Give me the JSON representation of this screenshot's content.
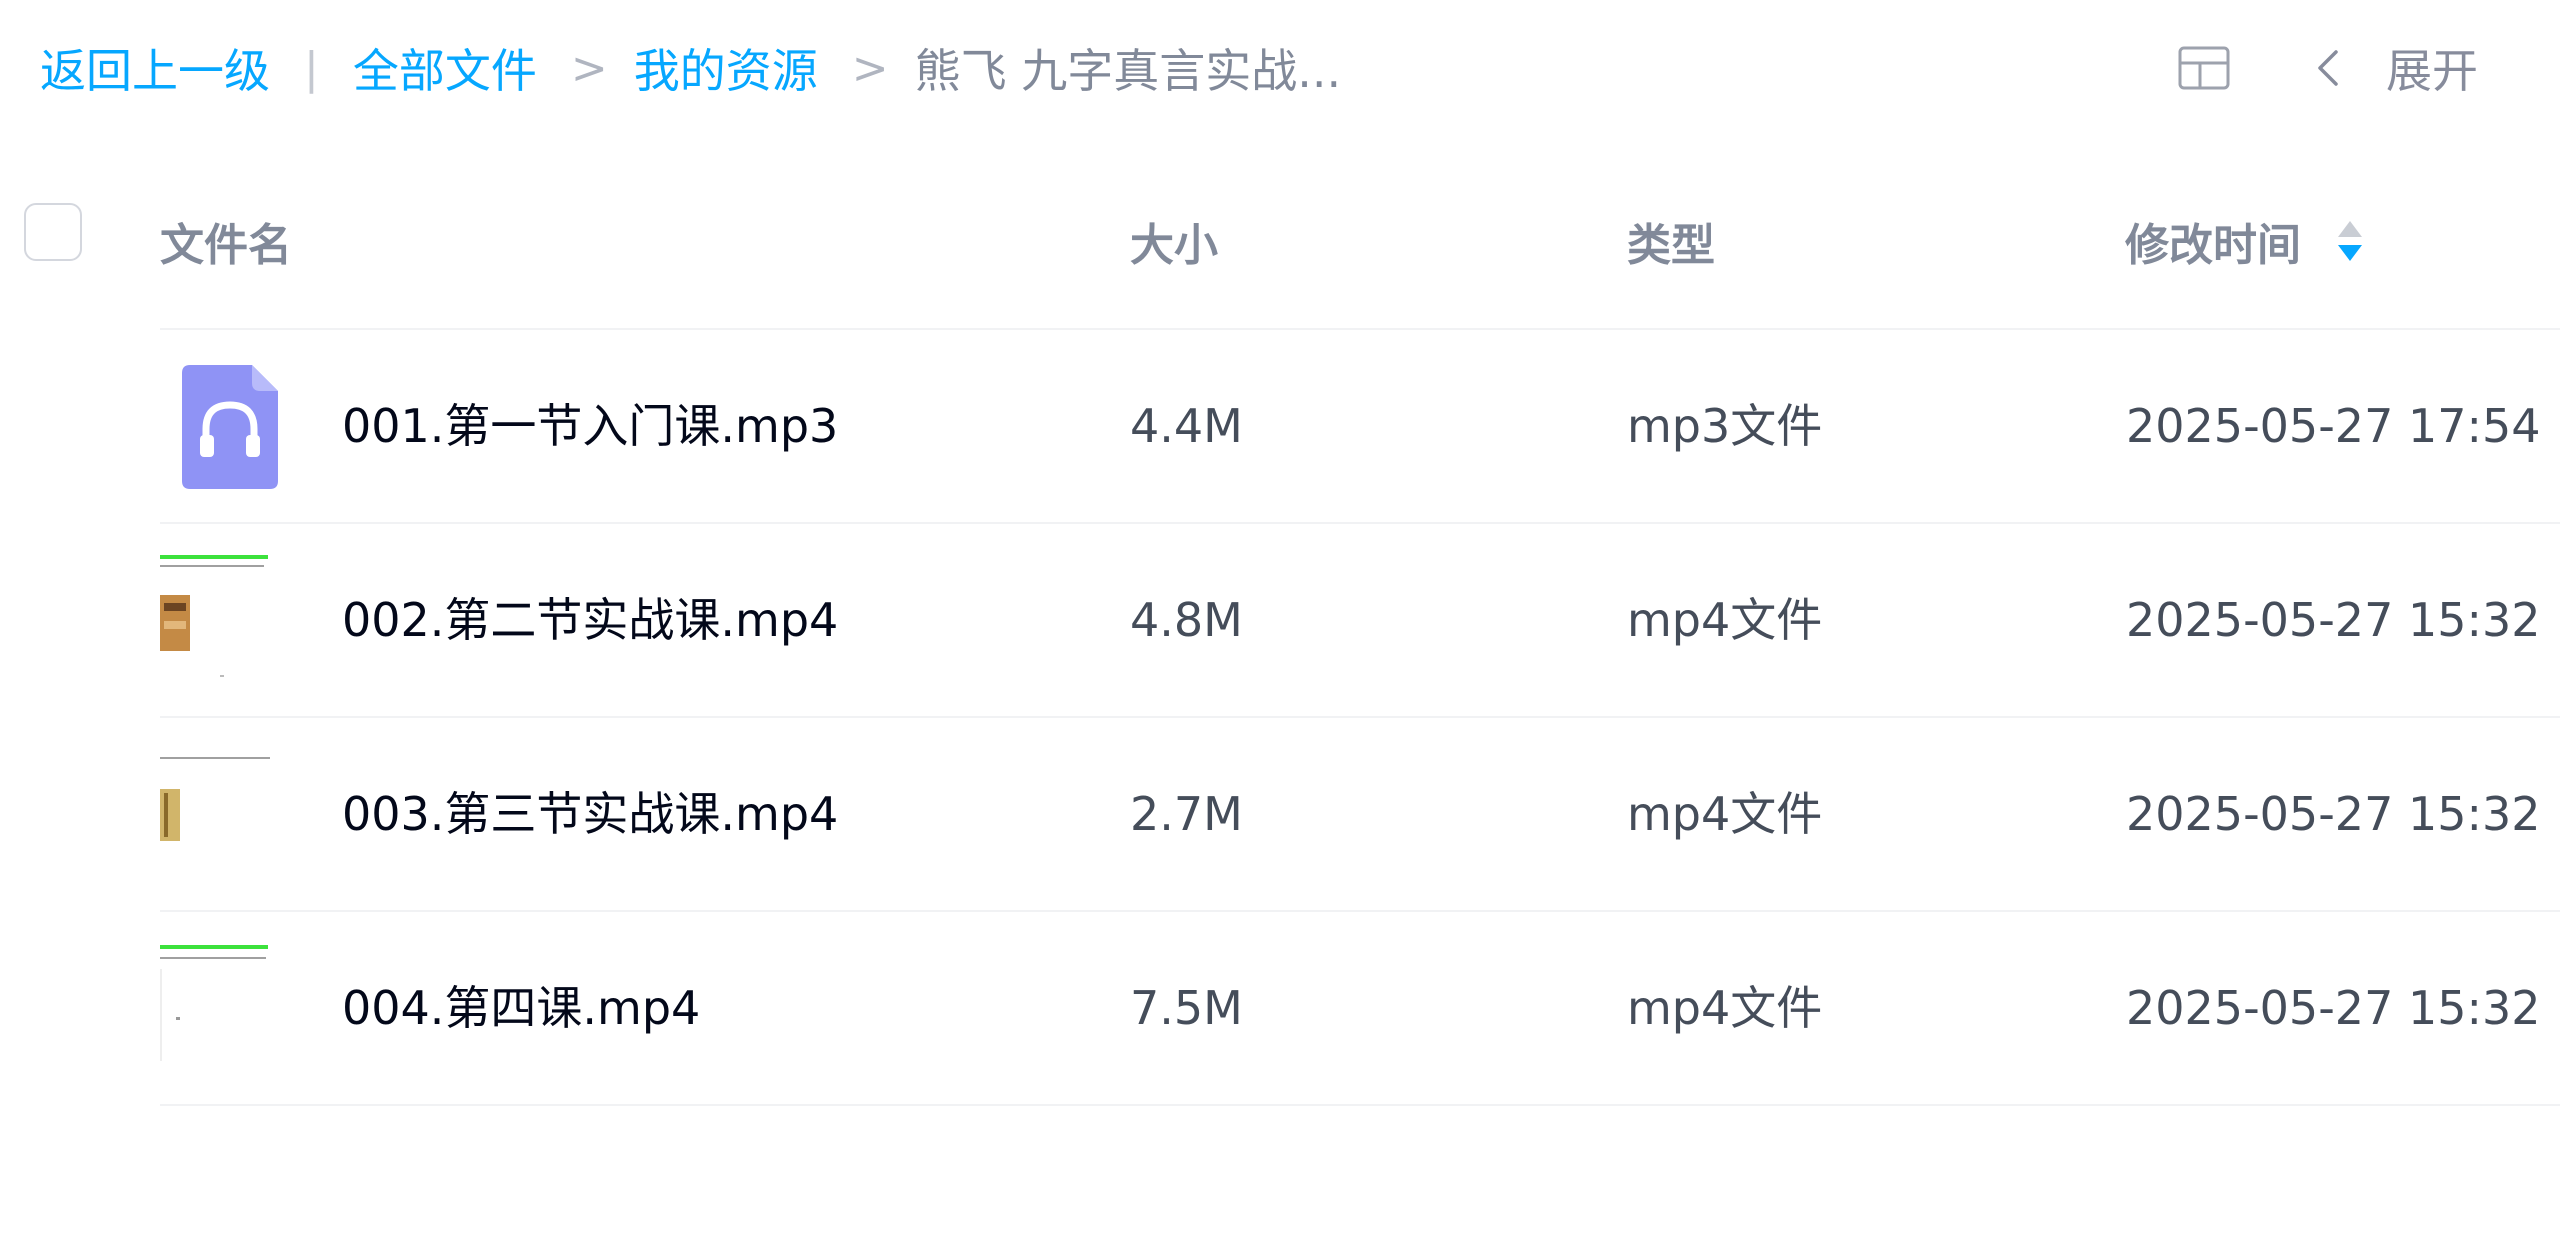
{
  "breadcrumb": {
    "back_label": "返回上一级",
    "divider": "|",
    "separator": ">",
    "items": [
      {
        "label": "全部文件"
      },
      {
        "label": "我的资源"
      }
    ],
    "current": "熊飞 九字真言实战..."
  },
  "toolbar": {
    "view_icon": "grid-view-icon",
    "collapse_icon": "chevron-left-icon",
    "expand_label": "展开"
  },
  "table": {
    "columns": {
      "name": "文件名",
      "size": "大小",
      "type": "类型",
      "modified": "修改时间"
    },
    "sort_icon": "sort-icon",
    "accent_color": "#06a7ff",
    "rows": [
      {
        "name": "001.第一节入门课.mp3",
        "size": "4.4M",
        "type": "mp3文件",
        "modified": "2025-05-27 17:54",
        "icon": "audio-file-icon"
      },
      {
        "name": "002.第二节实战课.mp4",
        "size": "4.8M",
        "type": "mp4文件",
        "modified": "2025-05-27 15:32",
        "icon": "video-thumbnail"
      },
      {
        "name": "003.第三节实战课.mp4",
        "size": "2.7M",
        "type": "mp4文件",
        "modified": "2025-05-27 15:32",
        "icon": "video-thumbnail"
      },
      {
        "name": "004.第四课.mp4",
        "size": "7.5M",
        "type": "mp4文件",
        "modified": "2025-05-27 15:32",
        "icon": "video-thumbnail"
      }
    ]
  }
}
